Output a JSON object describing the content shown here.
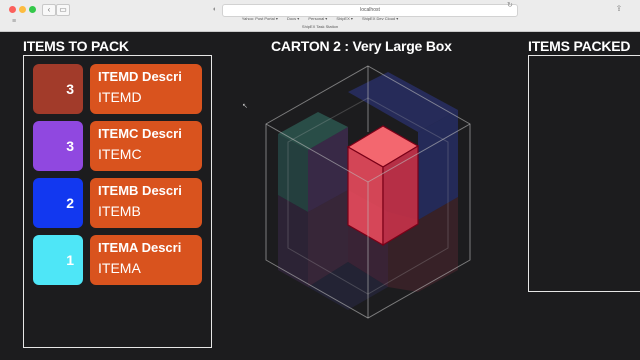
{
  "browser": {
    "url": "localhost",
    "bookmarks": [
      "Yahoo: Post Portal ▾",
      "Docs ▾",
      "Personal ▾",
      "ShipEX ▾",
      "ShipEX Dev Cloud ▾"
    ],
    "extra_tab": "ShipEX Task Station"
  },
  "left_heading": "ITEMS TO PACK",
  "center_heading": "CARTON 2 : Very Large Box",
  "right_heading": "ITEMS PACKED",
  "items": [
    {
      "qty": "3",
      "desc": "ITEMD Descri",
      "code": "ITEMD",
      "color": "#a23b2a"
    },
    {
      "qty": "3",
      "desc": "ITEMC Descri",
      "code": "ITEMC",
      "color": "#9048e0"
    },
    {
      "qty": "2",
      "desc": "ITEMB Descri",
      "code": "ITEMB",
      "color": "#1238f0"
    },
    {
      "qty": "1",
      "desc": "ITEMA Descri",
      "code": "ITEMA",
      "color": "#4ee6f7"
    }
  ],
  "colors": {
    "background": "#1c1c1e",
    "card": "#d9531e",
    "highlight_box": "#ff6b74"
  }
}
